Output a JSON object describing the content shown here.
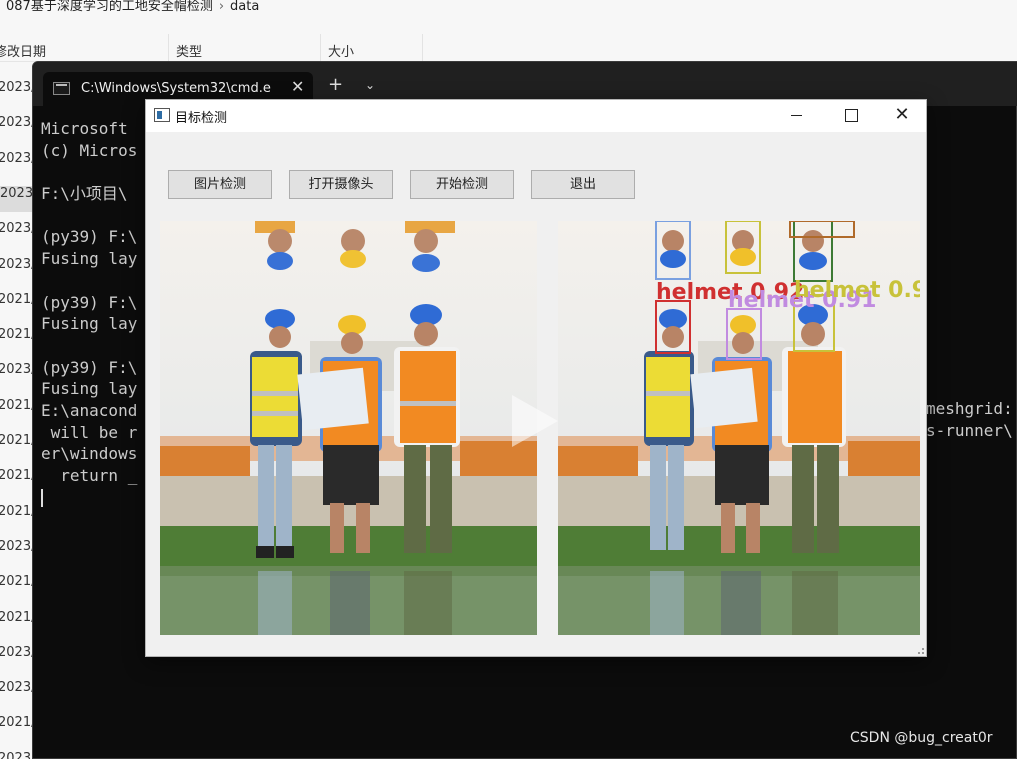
{
  "explorer": {
    "breadcrumb": [
      "087基于深度学习的工地安全帽检测",
      "data"
    ],
    "columns": {
      "date": "修改日期",
      "type": "类型",
      "size": "大小"
    },
    "date_rows": [
      "2023/",
      "2023/",
      "2023/",
      "2023/",
      "2023/",
      "2023/",
      "2021/",
      "2021/",
      "2023/",
      "2021/",
      "2021/",
      "2021/",
      "2021/",
      "2023/",
      "2021/",
      "2021/",
      "2023/",
      "2023/",
      "2021/",
      "2023/"
    ]
  },
  "terminal": {
    "tab_title": "C:\\Windows\\System32\\cmd.e",
    "tab_close": "✕",
    "new_tab": "+",
    "dropdown": "⌄",
    "lines": [
      "Microsoft",
      "(c) Micros",
      "",
      "F:\\小项目\\",
      "",
      "(py39) F:\\",
      "Fusing lay",
      "",
      "(py39) F:\\",
      "Fusing lay",
      "",
      "(py39) F:\\",
      "Fusing lay",
      "E:\\anacond",
      " will be r",
      "er\\windows",
      "  return _"
    ],
    "right_fragments": [
      "meshgrid:",
      "s-runner\\"
    ]
  },
  "app": {
    "title": "目标检测",
    "close_glyph": "✕",
    "buttons": {
      "image_detect": "图片检测",
      "open_camera": "打开摄像头",
      "start_detect": "开始检测",
      "exit": "退出"
    },
    "detections": [
      {
        "label": "helmet 0.92",
        "color": "#d03030"
      },
      {
        "label": "helmet 0.91",
        "color": "#c18be0"
      },
      {
        "label": "helmet 0.9",
        "color": "#c8c23a"
      }
    ]
  },
  "watermark": "CSDN @bug_creat0r"
}
